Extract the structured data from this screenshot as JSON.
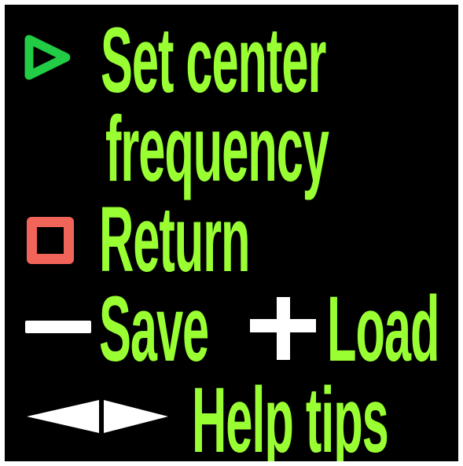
{
  "colors": {
    "background": "#000000",
    "text": "#99ff33",
    "play_icon": "#22cc44",
    "stop_icon": "#f0645a",
    "symbol": "#ffffff"
  },
  "menu": {
    "set_center_frequency": {
      "icon": "play-triangle-icon",
      "line1": "Set center",
      "line2": "frequency"
    },
    "return": {
      "icon": "square-icon",
      "label": "Return"
    },
    "save": {
      "icon": "minus-icon",
      "label": "Save"
    },
    "load": {
      "icon": "plus-icon",
      "label": "Load"
    },
    "help": {
      "icon": "left-right-arrows-icon",
      "label": "Help tips"
    }
  }
}
